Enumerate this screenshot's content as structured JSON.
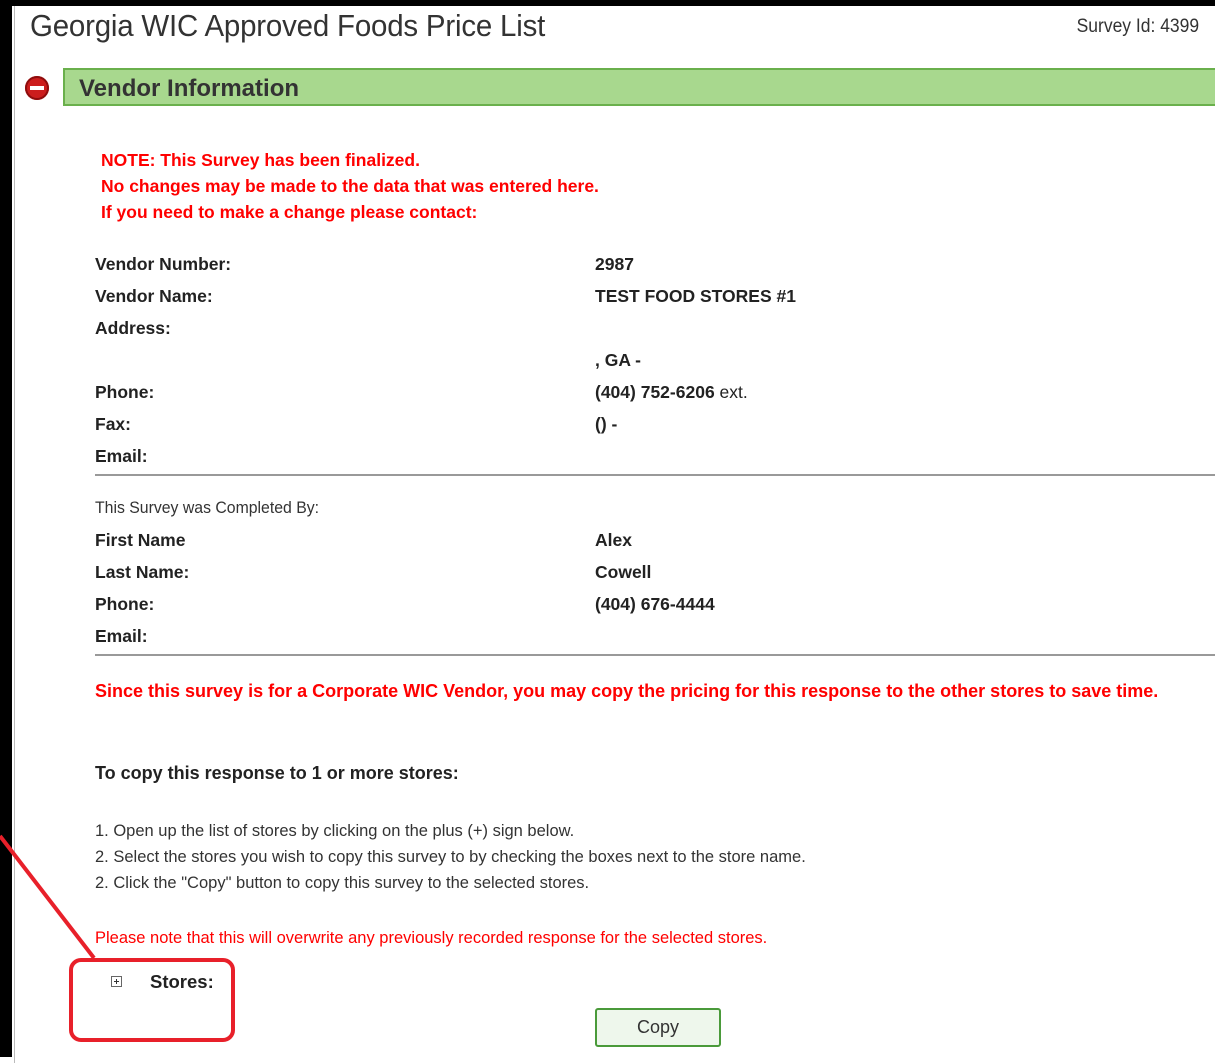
{
  "header": {
    "title": "Georgia WIC Approved Foods Price List",
    "survey_id": "Survey Id: 4399"
  },
  "section": {
    "title": "Vendor Information"
  },
  "note": {
    "line1": "NOTE: This Survey has been finalized.",
    "line2": "No changes may be made to the data that was entered here.",
    "line3": "If you need to make a change please contact:"
  },
  "vendor": {
    "number_label": "Vendor Number:",
    "number_value": "2987",
    "name_label": "Vendor Name:",
    "name_value": "TEST FOOD STORES #1",
    "address_label": "Address:",
    "address_city_line": ", GA  -",
    "phone_label": "Phone:",
    "phone_value": "(404) 752-6206",
    "phone_ext": "ext.",
    "fax_label": "Fax:",
    "fax_value": "() -",
    "email_label": "Email:"
  },
  "completed_by": {
    "heading": "This Survey was Completed By:",
    "first_name_label": "First Name",
    "first_name_value": "Alex",
    "last_name_label": "Last Name:",
    "last_name_value": "Cowell",
    "phone_label": "Phone:",
    "phone_value": "(404) 676-4444",
    "email_label": "Email:"
  },
  "corporate_note": "Since this survey is for a Corporate WIC Vendor, you may copy the pricing for this response to the other stores to save time.",
  "copy_instructions": {
    "heading": "To copy this response to 1 or more stores:",
    "step1": "1. Open up the list of stores by clicking on the plus (+) sign below.",
    "step2": "2. Select the stores you wish to copy this survey to by checking the boxes next to the store name.",
    "step3": "2. Click the \"Copy\" button to copy this survey to the selected stores.",
    "overwrite_note": "Please note that this will overwrite any previously recorded response for the selected stores."
  },
  "stores": {
    "label": "Stores:"
  },
  "buttons": {
    "copy_label": "Copy"
  },
  "colors": {
    "header_green": "#a8d88e",
    "header_border": "#6ab04c",
    "note_red": "#ff0000",
    "highlight_red": "#e8202a"
  }
}
